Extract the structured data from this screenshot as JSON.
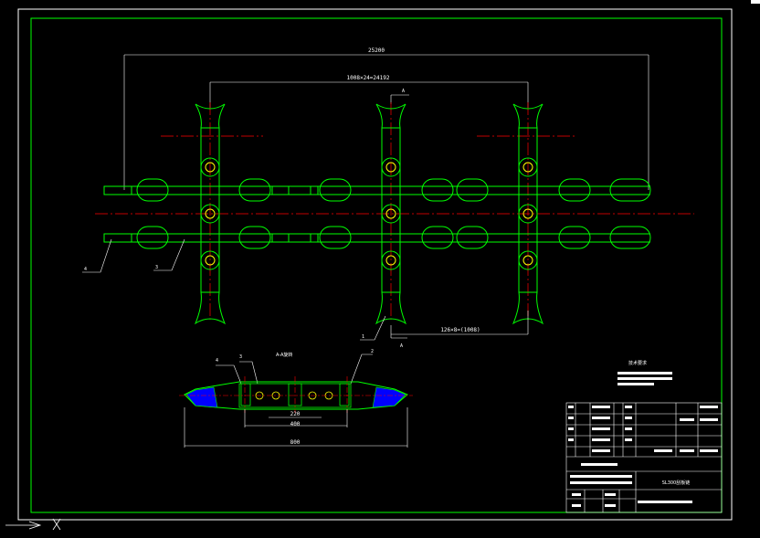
{
  "drawing": {
    "overall_length": "25200",
    "flight_spacing": "1008×24=24192",
    "link_spacing": "126×8=(1008)",
    "section_mark_top": "A",
    "section_mark_bottom": "A",
    "section_title": "A-A旋转",
    "callouts": [
      "4",
      "3",
      "1",
      "4",
      "3",
      "2"
    ],
    "section_dims": [
      "220",
      "400",
      "800"
    ],
    "notes_title": "技术要求",
    "drawing_title": "SL300刮板链",
    "colors": {
      "frame": "#00ff00",
      "outline": "#00ff00",
      "centerline": "#ff0000",
      "dimension": "#ffffff",
      "bolt": "#ffff00",
      "hatch": "#0000ff",
      "background": "#000000"
    }
  },
  "ucs_icon": "ucs-axis-icon"
}
